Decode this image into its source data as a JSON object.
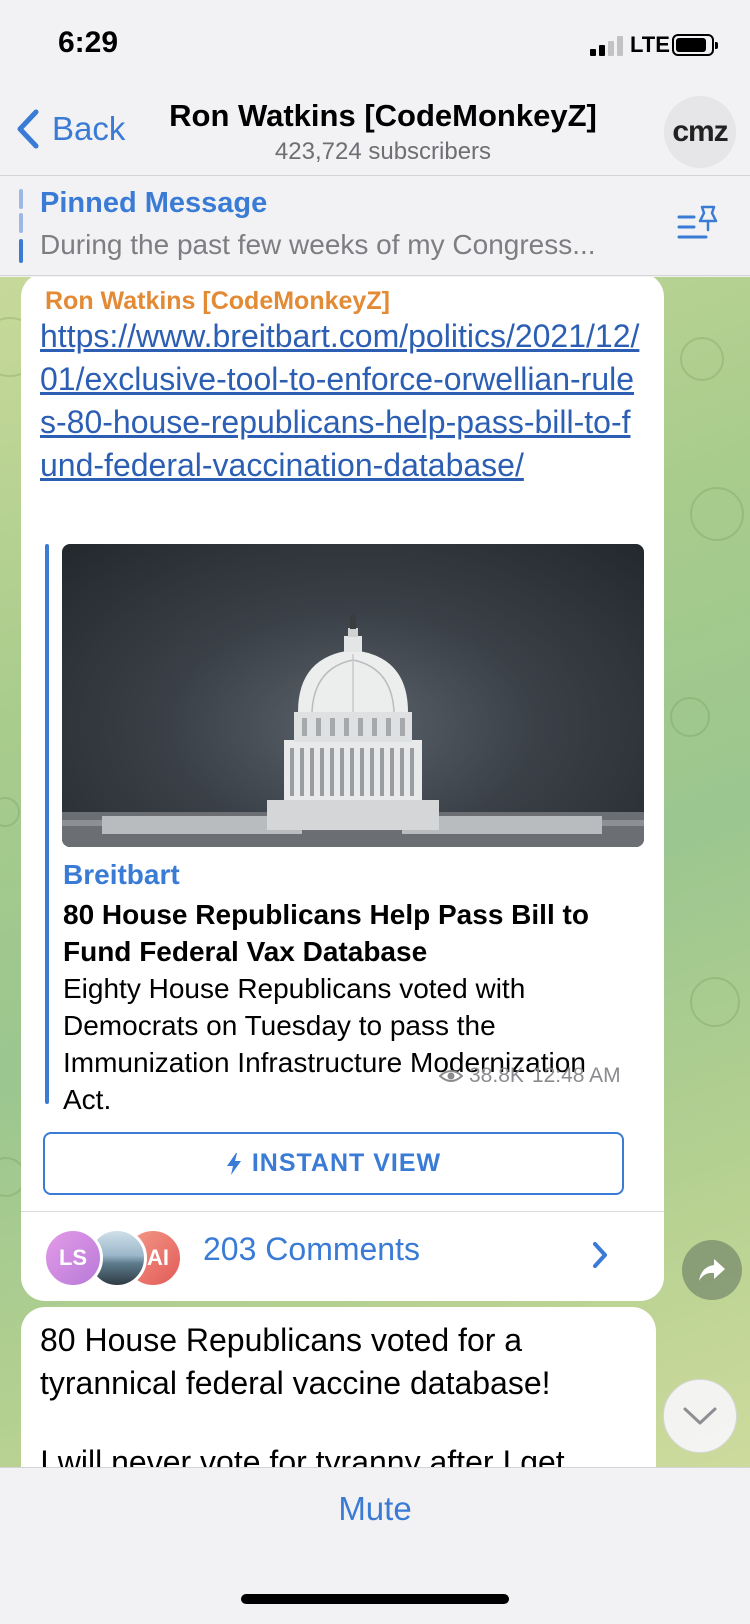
{
  "status_bar": {
    "time": "6:29",
    "network": "LTE"
  },
  "header": {
    "back_label": "Back",
    "title": "Ron Watkins [CodeMonkeyZ]",
    "subtitle": "423,724 subscribers",
    "avatar_text": "cmz"
  },
  "pinned": {
    "label": "Pinned Message",
    "text": "During the past few weeks of my Congress..."
  },
  "message1": {
    "sender": "Ron Watkins [CodeMonkeyZ]",
    "link": "https://www.breitbart.com/politics/2021/12/01/exclusive-tool-to-enforce-orwellian-rules-80-house-republicans-help-pass-bill-to-fund-federal-vaccination-database/",
    "preview": {
      "site": "Breitbart",
      "title": "80 House Republicans Help Pass Bill to Fund Federal Vax Database",
      "description": "Eighty House Republicans voted with Democrats on Tuesday to pass the Immunization Infrastructure Modernization Act."
    },
    "views": "38.8K",
    "time": "12:48 AM",
    "instant_view_label": "INSTANT VIEW",
    "comments": {
      "avatars": [
        "LS",
        "",
        "AI"
      ],
      "label": "203 Comments"
    }
  },
  "message2": {
    "line1": "80 House Republicans voted for a tyrannical federal vaccine database!",
    "line2": "I will never vote for tyranny after I get"
  },
  "bottom_bar": {
    "mute_label": "Mute"
  },
  "colors": {
    "accent": "#3a7bd5",
    "sender": "#e38a35",
    "link": "#2c5fb3"
  },
  "icons": {
    "back": "chevron-left-icon",
    "pin_list": "pin-list-icon",
    "views": "eye-icon",
    "instant_view": "lightning-icon",
    "share": "share-arrow-icon",
    "scroll_down": "chevron-down-icon"
  }
}
